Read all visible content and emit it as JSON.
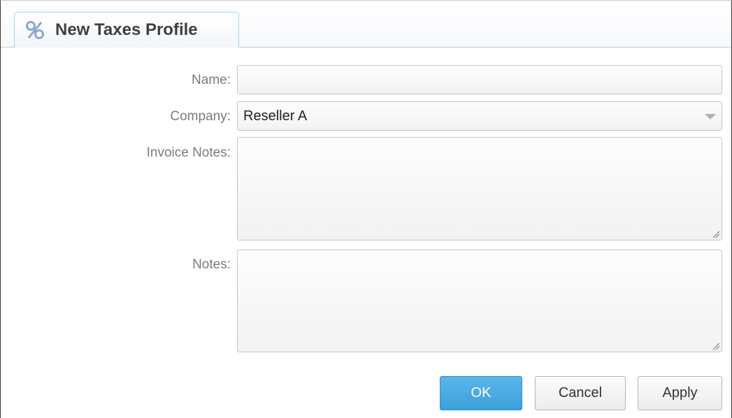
{
  "window": {
    "tab_title": "New Taxes Profile",
    "tab_icon": "percent-icon"
  },
  "form": {
    "name_label": "Name:",
    "name_value": "",
    "company_label": "Company:",
    "company_value": "Reseller A",
    "invoice_notes_label": "Invoice Notes:",
    "invoice_notes_value": "",
    "notes_label": "Notes:",
    "notes_value": ""
  },
  "buttons": {
    "ok_label": "OK",
    "cancel_label": "Cancel",
    "apply_label": "Apply"
  },
  "colors": {
    "accent": "#3aa0dc",
    "tab_border": "#b7cde4",
    "label_text": "#7a7a7a"
  }
}
